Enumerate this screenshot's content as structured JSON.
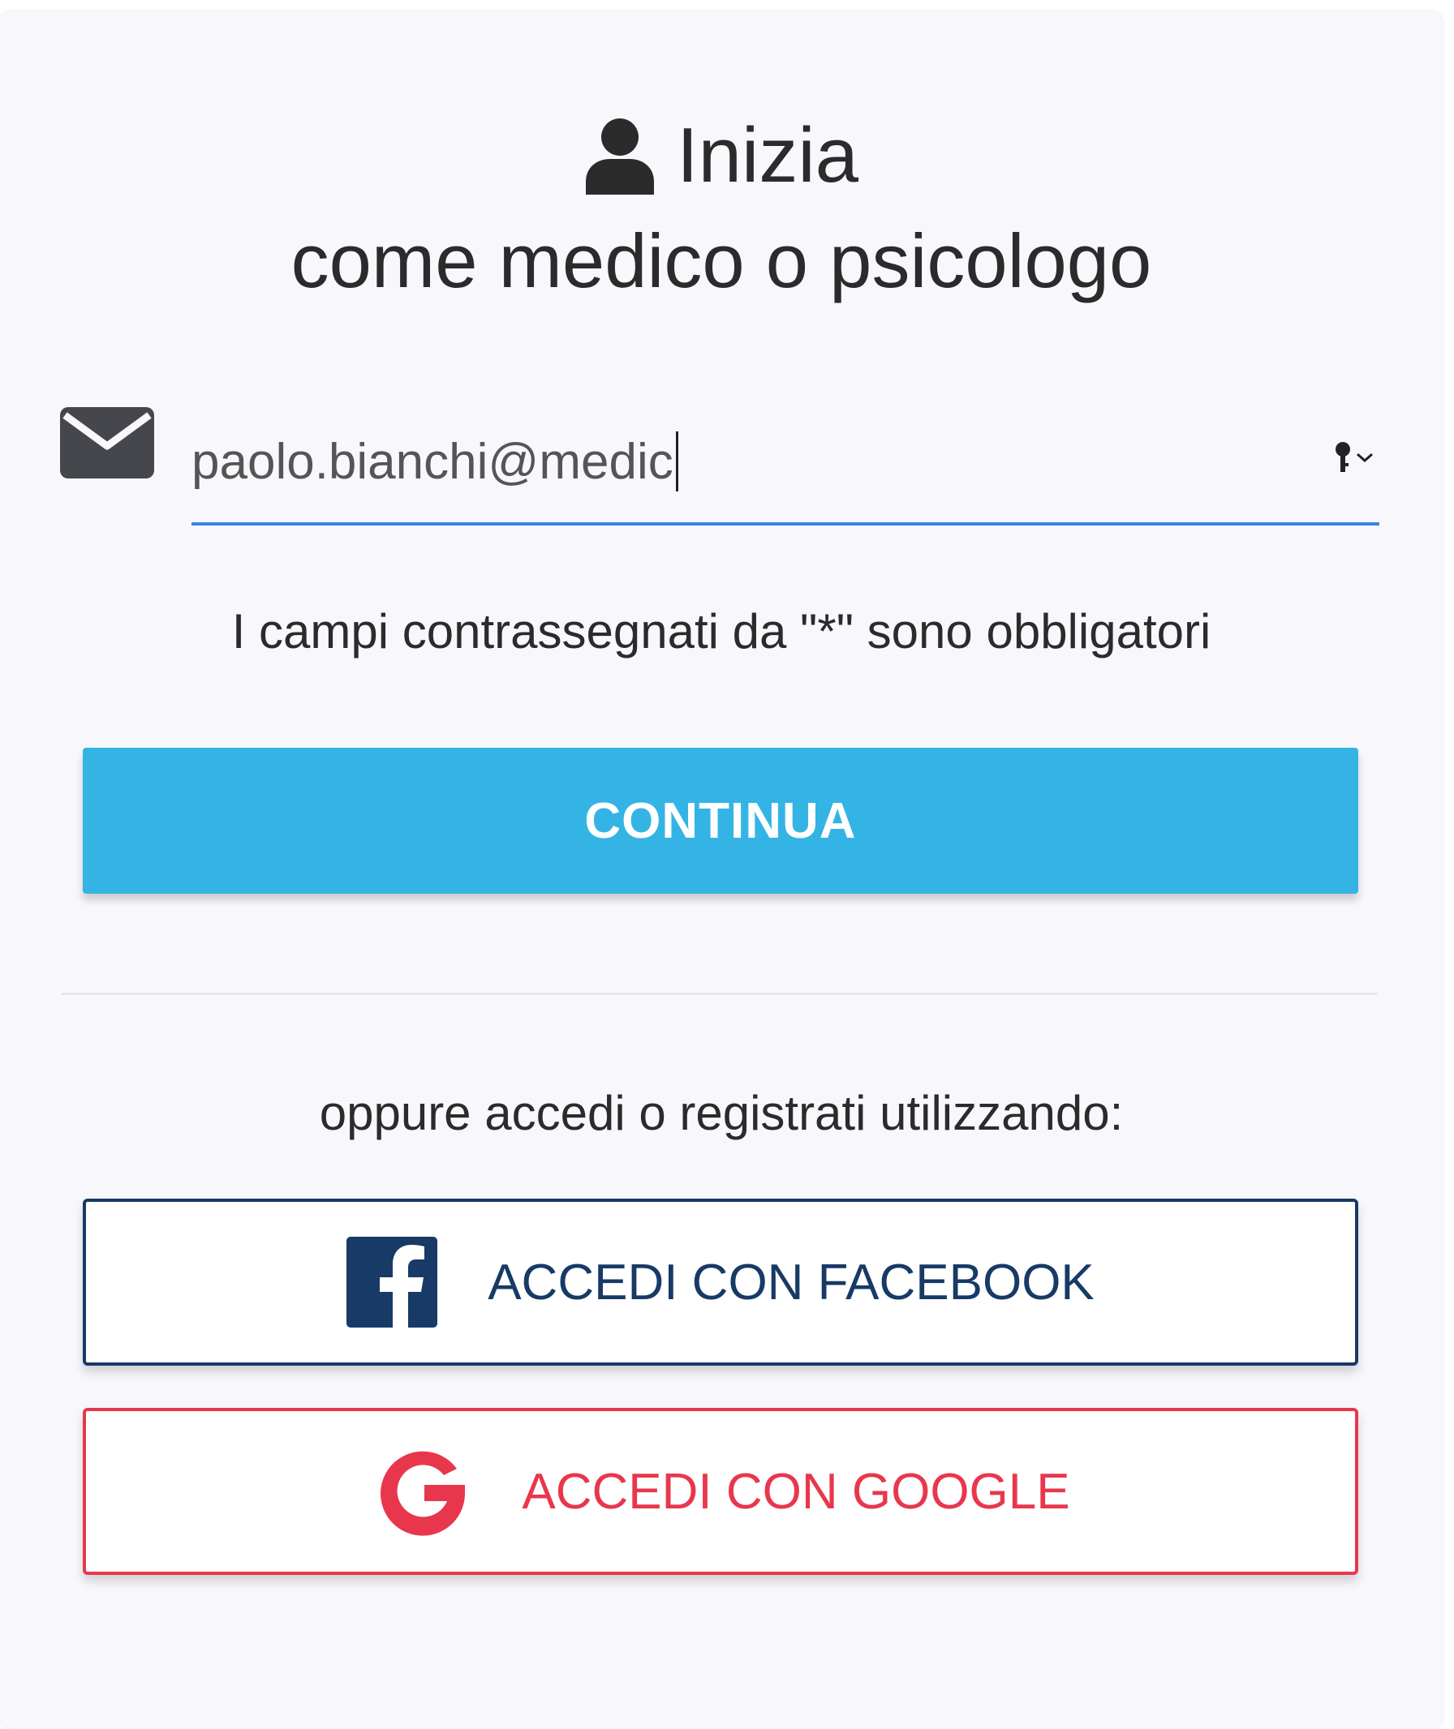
{
  "header": {
    "title": "Inizia",
    "subtitle": "come medico o psicologo"
  },
  "email": {
    "value": "paolo.bianchi@medic"
  },
  "form": {
    "required_note": "I campi contrassegnati da \"*\" sono obbligatori",
    "continue_label": "CONTINUA"
  },
  "social": {
    "or_text": "oppure accedi o registrati utilizzando:",
    "facebook_label": "ACCEDI CON FACEBOOK",
    "google_label": "ACCEDI CON GOOGLE"
  },
  "icons": {
    "title": "user-icon",
    "email": "envelope-icon",
    "autofill": "key-icon",
    "facebook": "facebook-icon",
    "google": "google-icon"
  },
  "colors": {
    "primary": "#34b4e4",
    "input_underline": "#3b82e6",
    "facebook": "#173a66",
    "google": "#e8374d",
    "text": "#2b2b2b"
  }
}
